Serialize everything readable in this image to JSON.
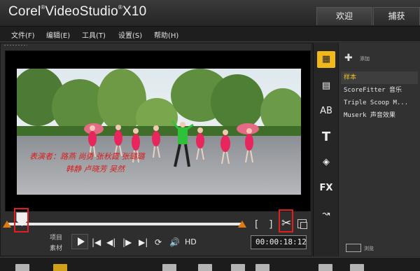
{
  "window": {
    "brand": "Corel",
    "product": "VideoStudio",
    "version": "X10"
  },
  "tabs": [
    {
      "label": "欢迎"
    },
    {
      "label": "捕获"
    }
  ],
  "menu": [
    {
      "label": "文件(F)"
    },
    {
      "label": "编辑(E)"
    },
    {
      "label": "工具(T)"
    },
    {
      "label": "设置(S)"
    },
    {
      "label": "帮助(H)"
    }
  ],
  "player": {
    "caption_line1": "表演者：路燕 尚勇 张秋霞 张璐璐",
    "caption_line2": "韩静 卢晓芳 吴然",
    "project_label": "项目",
    "clip_label": "素材",
    "hd_label": "HD",
    "timecode": "00:00:18:12",
    "mark_in": "[",
    "mark_out": "]",
    "scrub_position": 0.06
  },
  "library": {
    "add_label": "添加",
    "items": [
      {
        "label": "样本",
        "selected": true
      },
      {
        "label": "ScoreFitter 音乐",
        "selected": false
      },
      {
        "label": "Triple Scoop M...",
        "selected": false
      },
      {
        "label": "Muserk 声音效果",
        "selected": false
      }
    ],
    "browse_label": "浏览"
  },
  "side_icons": [
    "media-icon",
    "instant-project-icon",
    "transition-icon",
    "title-icon",
    "graphic-icon",
    "filter-icon",
    "path-icon"
  ],
  "colors": {
    "accent_orange": "#e07a10",
    "highlight_red": "#e02020",
    "selected_text": "#f0c020"
  }
}
